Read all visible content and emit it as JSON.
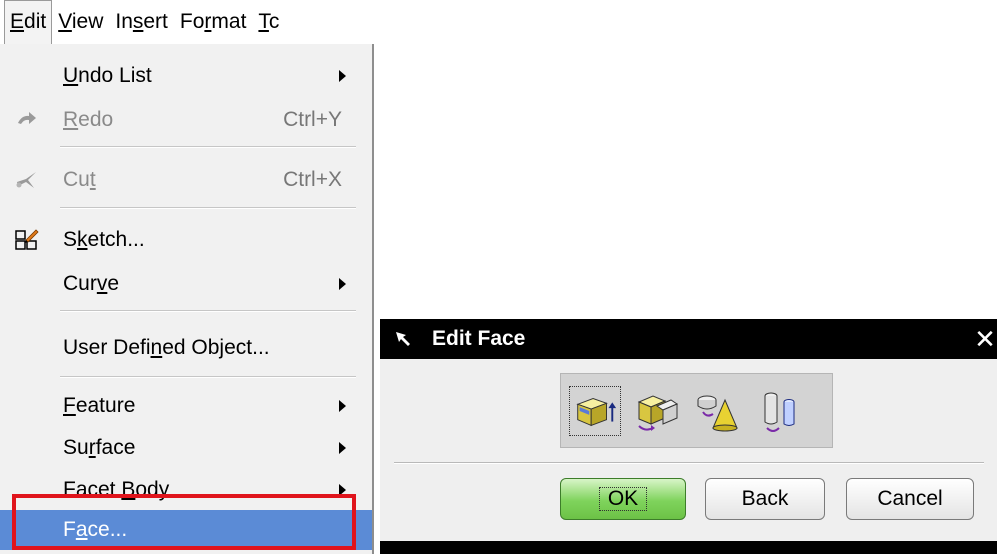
{
  "menubar": {
    "items": [
      {
        "label": "Edit",
        "ul": "E",
        "rest": "dit"
      },
      {
        "label": "View",
        "ul": "V",
        "rest": "iew"
      },
      {
        "label": "Insert",
        "pre": "In",
        "ul": "s",
        "rest": "ert"
      },
      {
        "label": "Format",
        "pre": "Fo",
        "ul": "r",
        "rest": "mat"
      },
      {
        "label": "Tc",
        "ul": "T",
        "rest": "c"
      }
    ]
  },
  "menu": {
    "undo_list": {
      "pre": "",
      "ul": "U",
      "rest": "ndo List"
    },
    "redo": {
      "pre": "",
      "ul": "R",
      "rest": "edo",
      "shortcut": "Ctrl+Y"
    },
    "cut": {
      "pre": "Cu",
      "ul": "t",
      "rest": "",
      "shortcut": "Ctrl+X"
    },
    "sketch": {
      "pre": "S",
      "ul": "k",
      "rest": "etch..."
    },
    "curve": {
      "pre": "Cur",
      "ul": "v",
      "rest": "e"
    },
    "user_defined": {
      "pre": "User Defi",
      "ul": "n",
      "rest": "ed Object..."
    },
    "feature": {
      "pre": "",
      "ul": "F",
      "rest": "eature"
    },
    "surface": {
      "pre": "Su",
      "ul": "r",
      "rest": "face"
    },
    "facet_body": {
      "pre": "Facet ",
      "ul": "B",
      "rest": "ody"
    },
    "face": {
      "pre": "F",
      "ul": "a",
      "rest": "ce..."
    }
  },
  "dialog": {
    "title": "Edit Face",
    "ok_label": "OK",
    "back_label": "Back",
    "cancel_label": "Cancel",
    "tools": [
      "move-face-icon",
      "offset-face-icon",
      "taper-face-icon",
      "resize-face-icon"
    ]
  },
  "colors": {
    "selected_row": "#5b8bd6",
    "highlight_box": "#e0141c",
    "ok_button": "#7fd35c",
    "title_bar": "#000000"
  }
}
